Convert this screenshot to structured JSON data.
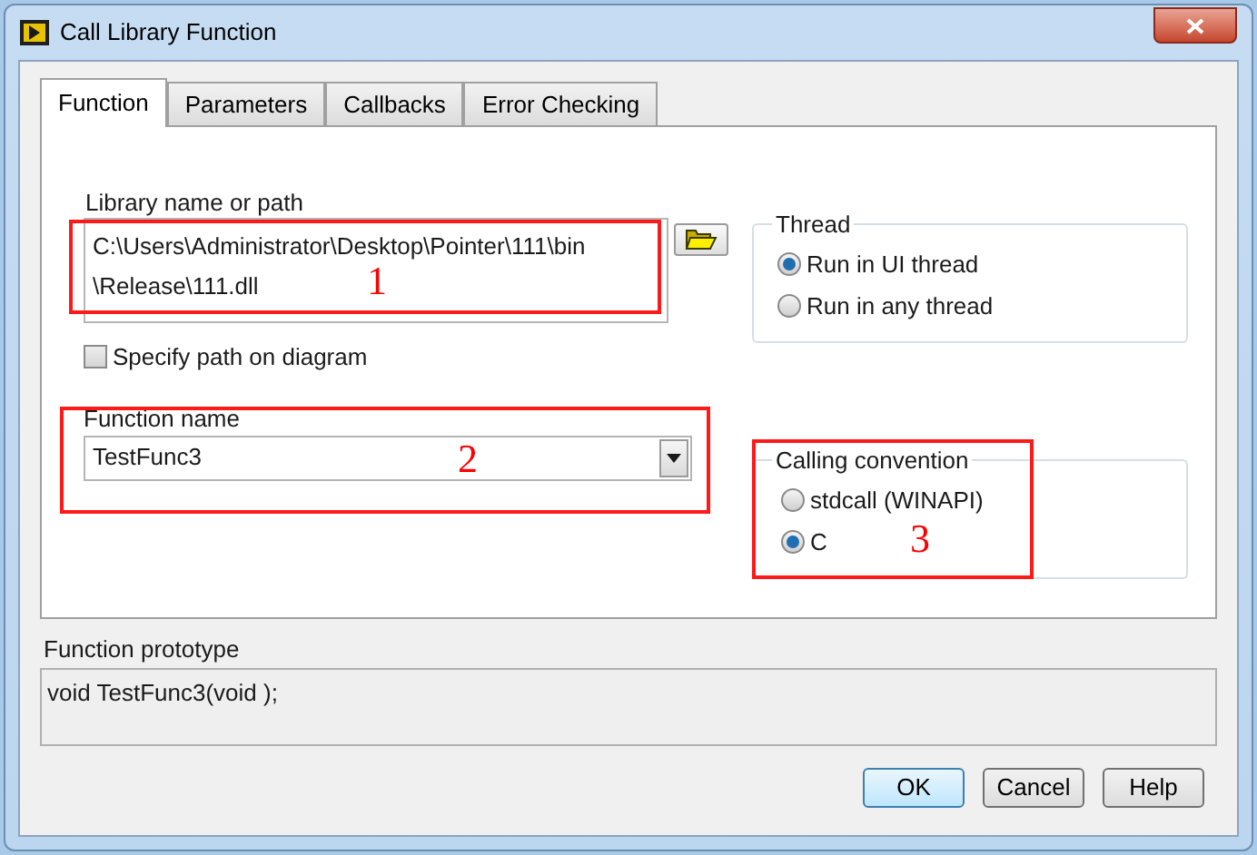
{
  "window": {
    "title": "Call Library Function"
  },
  "tabs": [
    {
      "label": "Function",
      "selected": true
    },
    {
      "label": "Parameters",
      "selected": false
    },
    {
      "label": "Callbacks",
      "selected": false
    },
    {
      "label": "Error Checking",
      "selected": false
    }
  ],
  "library": {
    "label": "Library name or path",
    "value": "C:\\Users\\Administrator\\Desktop\\Pointer\\111\\bin\\Release\\111.dll"
  },
  "specify_path": {
    "label": "Specify path on diagram",
    "checked": false
  },
  "function_name": {
    "label": "Function name",
    "value": "TestFunc3"
  },
  "thread": {
    "title": "Thread",
    "options": [
      {
        "label": "Run in UI thread",
        "selected": true
      },
      {
        "label": "Run in any thread",
        "selected": false
      }
    ]
  },
  "calling_convention": {
    "title": "Calling convention",
    "options": [
      {
        "label": "stdcall (WINAPI)",
        "selected": false
      },
      {
        "label": "C",
        "selected": true
      }
    ]
  },
  "prototype": {
    "label": "Function prototype",
    "value": "void  TestFunc3(void );"
  },
  "annotations": [
    "1",
    "2",
    "3"
  ],
  "buttons": [
    "OK",
    "Cancel",
    "Help"
  ]
}
